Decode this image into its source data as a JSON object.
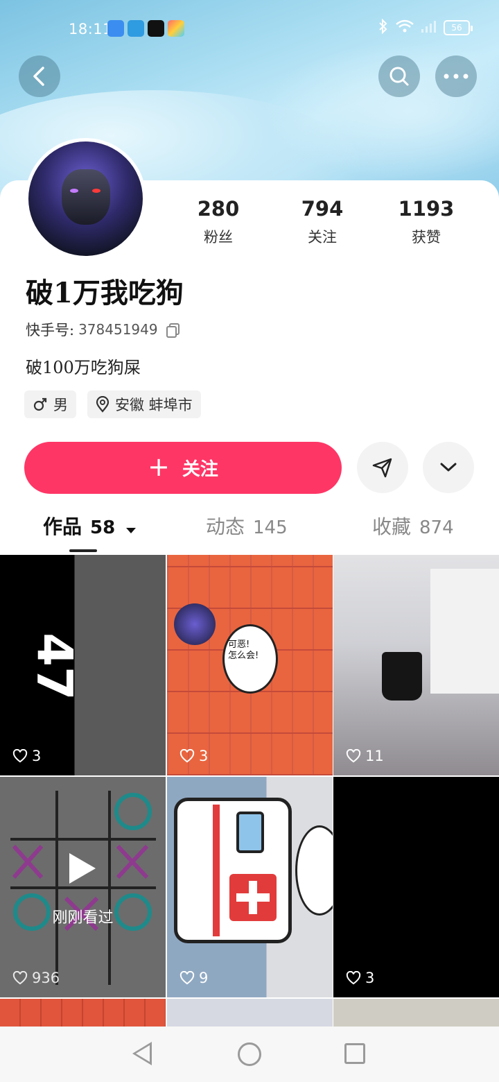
{
  "status_bar": {
    "time": "18:11",
    "battery": "56"
  },
  "profile": {
    "name": "破1万我吃狗",
    "kuaishou_id_label": "快手号:",
    "kuaishou_id": "378451949",
    "bio": "破100万吃狗屎",
    "gender_tag": "男",
    "location_tag": "安徽 蚌埠市",
    "follow_label": "关注"
  },
  "stats": [
    {
      "num": "280",
      "label": "粉丝"
    },
    {
      "num": "794",
      "label": "关注"
    },
    {
      "num": "1193",
      "label": "获赞"
    }
  ],
  "tabs": [
    {
      "label": "作品",
      "count": "58"
    },
    {
      "label": "动态",
      "count": "145"
    },
    {
      "label": "收藏",
      "count": "874"
    }
  ],
  "videos": [
    {
      "likes": "3",
      "overlay_text": "47"
    },
    {
      "likes": "3",
      "overlay_text": "可恶!\n怎么会!"
    },
    {
      "likes": "11"
    },
    {
      "likes": "936",
      "seen_label": "刚刚看过"
    },
    {
      "likes": "9"
    },
    {
      "likes": "3"
    }
  ],
  "colors": {
    "accent": "#fe3666",
    "header_bg": "#a7dcf1"
  }
}
